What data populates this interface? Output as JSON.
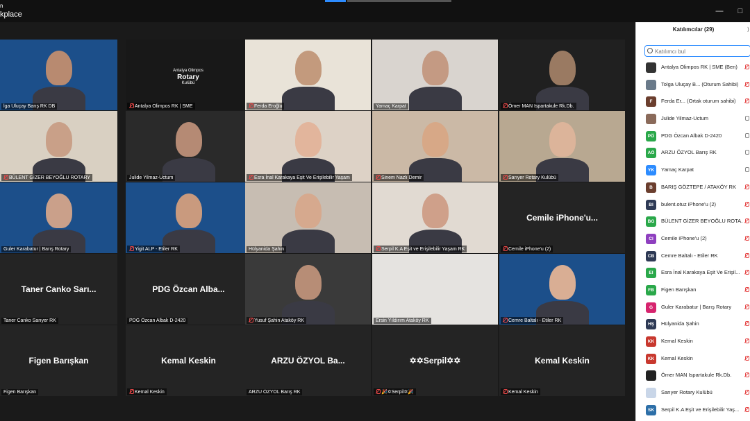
{
  "window": {
    "title": "kplace",
    "title_top": "n"
  },
  "panel": {
    "title": "Katılımcılar (29)",
    "search_placeholder": "Katılımcı bul",
    "participants": [
      {
        "initials": "",
        "name": "Antalya Olimpos RK | SME (Ben)",
        "color": "#333333",
        "mic": "muted"
      },
      {
        "initials": "",
        "name": "Tolga Uluçay B...  (Oturum Sahibi)",
        "color": "#6a7a8a",
        "mic": "muted"
      },
      {
        "initials": "F",
        "name": "Ferda Er...  (Ortak oturum sahibi)",
        "color": "#6b3e2e",
        "mic": "muted"
      },
      {
        "initials": "",
        "name": "Julide Yilmaz-Uctum",
        "color": "#8a6a5a",
        "mic": "on"
      },
      {
        "initials": "PÖ",
        "name": "PDG Özcan Albak D-2420",
        "color": "#2aa84a",
        "mic": "on"
      },
      {
        "initials": "AÖ",
        "name": "ARZU ÖZYOL Barış RK",
        "color": "#2aa84a",
        "mic": "on"
      },
      {
        "initials": "YK",
        "name": "Yamaç Karpat",
        "color": "#2d8cff",
        "mic": "on"
      },
      {
        "initials": "B",
        "name": "BARIŞ GÖZTEPE / ATAKÖY RK",
        "color": "#6b3e2e",
        "mic": "muted"
      },
      {
        "initials": "BI",
        "name": "bulent.otuz iPhone'u (2)",
        "color": "#2e3a55",
        "mic": "muted"
      },
      {
        "initials": "BG",
        "name": "BÜLENT GİZER BEYOĞLU ROTA...",
        "color": "#2aa84a",
        "mic": "muted"
      },
      {
        "initials": "CI",
        "name": "Cemile iPhone'u (2)",
        "color": "#8e3fbf",
        "mic": "muted"
      },
      {
        "initials": "CB",
        "name": "Cemre Baltalı - Etiler RK",
        "color": "#2e3a55",
        "mic": "muted"
      },
      {
        "initials": "EI",
        "name": "Esra İnal Karakaya Eşit Ve Erişil...",
        "color": "#2aa84a",
        "mic": "muted"
      },
      {
        "initials": "FB",
        "name": "Figen Barışkan",
        "color": "#2aa84a",
        "mic": "muted"
      },
      {
        "initials": "G",
        "name": "Guler Karabatur | Barış Rotary",
        "color": "#d6246e",
        "mic": "muted"
      },
      {
        "initials": "HŞ",
        "name": "Hülyanida Şahin",
        "color": "#2e3a55",
        "mic": "muted"
      },
      {
        "initials": "KK",
        "name": "Kemal Keskin",
        "color": "#c8382e",
        "mic": "muted"
      },
      {
        "initials": "KK",
        "name": "Kemal Keskin",
        "color": "#c8382e",
        "mic": "muted"
      },
      {
        "initials": "",
        "name": "Ömer MAN   Ispartakule  Rk.Db.",
        "color": "#222222",
        "mic": "muted"
      },
      {
        "initials": "",
        "name": "Sarıyer Rotary Kulübü",
        "color": "#c9d6e8",
        "mic": "muted"
      },
      {
        "initials": "SK",
        "name": "Serpil K.A Eşit ve Erişilebilir Yaş...",
        "color": "#2d6fa8",
        "mic": "muted"
      }
    ]
  },
  "tiles": [
    {
      "name": "lga Uluçay Barış RK DB",
      "big": "",
      "mic": false,
      "bg": "#1c4f8a",
      "person": "#b88a70"
    },
    {
      "name": "Antalya Olimpos RK | SME",
      "big": "",
      "mic": true,
      "bg": "#181818",
      "person": "",
      "logo_text": "Antalya Olimpos",
      "logo_brand": "Rotary",
      "logo_sub": "Kulübü"
    },
    {
      "name": "Ferda Eroğlu",
      "big": "",
      "mic": true,
      "bg": "#e9e3d8",
      "person": "#c39a7d"
    },
    {
      "name": "Yamaç Karpat",
      "big": "",
      "mic": false,
      "bg": "#d9d4cf",
      "person": "#c49a83"
    },
    {
      "name": "Ömer MAN   Ispartakule  Rk.Db.",
      "big": "",
      "mic": true,
      "bg": "#202020",
      "person": "#9a7a62"
    },
    {
      "name": "BÜLENT GİZER BEYOĞLU ROTARY",
      "big": "",
      "mic": true,
      "bg": "#d9d0c2",
      "person": "#c9a088"
    },
    {
      "name": "Julide Yilmaz-Uctum",
      "big": "",
      "mic": false,
      "bg": "#2a2a2a",
      "person": "#b58a74"
    },
    {
      "name": "Esra İnal Karakaya Eşit Ve Erişilebilir Yaşam",
      "big": "",
      "mic": true,
      "bg": "#ddd2c6",
      "person": "#e2b59c"
    },
    {
      "name": "Sinem Nazlı Demir",
      "big": "",
      "mic": true,
      "bg": "#cbb9a6",
      "person": "#d7a887"
    },
    {
      "name": "Sarıyer Rotary Kulübü",
      "big": "",
      "mic": true,
      "bg": "#b8a891",
      "person": "#dcb49a"
    },
    {
      "name": "Guler Karabatur | Barış Rotary",
      "big": "",
      "mic": false,
      "bg": "#1c4f8a",
      "person": "#caa08a"
    },
    {
      "name": "Yigit ALP - Etiler RK",
      "big": "",
      "mic": true,
      "bg": "#1c4f8a",
      "person": "#c99a7e"
    },
    {
      "name": "Hülyanida Şahin",
      "big": "",
      "mic": false,
      "bg": "#c7bdb2",
      "person": "#d6a98e"
    },
    {
      "name": "Serpil K.A Eşit ve Erişilebilir Yaşam RK",
      "big": "",
      "mic": true,
      "bg": "#e1dad2",
      "person": "#cfa08a"
    },
    {
      "name": "Cemile iPhone'u (2)",
      "big": "Cemile  iPhone'u...",
      "mic": true,
      "bg": "#242424",
      "person": ""
    },
    {
      "name": "Taner Canko Sarıyer RK",
      "big": "Taner Canko Sarı...",
      "mic": false,
      "bg": "#242424",
      "person": ""
    },
    {
      "name": "PDG Özcan Albak D-2420",
      "big": "PDG Özcan Alba...",
      "mic": false,
      "bg": "#242424",
      "person": ""
    },
    {
      "name": "Yusuf Şahin Ataköy RK",
      "big": "",
      "mic": true,
      "bg": "#3a3a3a",
      "person": "#b78d76"
    },
    {
      "name": "Ersin Yıldırım Ataköy RK",
      "big": "",
      "mic": false,
      "bg": "#e5e3e0",
      "person": ""
    },
    {
      "name": "Cemre Baltalı - Etiler RK",
      "big": "",
      "mic": true,
      "bg": "#1c4f8a",
      "person": "#d9ae94"
    },
    {
      "name": "Figen Barışkan",
      "big": "Figen Barışkan",
      "mic": false,
      "bg": "#242424",
      "person": ""
    },
    {
      "name": "Kemal Keskin",
      "big": "Kemal Keskin",
      "mic": true,
      "bg": "#242424",
      "person": ""
    },
    {
      "name": "ARZU ÖZYOL Barış RK",
      "big": "ARZU  ÖZYOL Ba...",
      "mic": false,
      "bg": "#242424",
      "person": ""
    },
    {
      "name": "🎉✡Serpil✡🎉",
      "big": "✡✡Serpil✡✡",
      "mic": true,
      "bg": "#242424",
      "person": ""
    },
    {
      "name": "Kemal Keskin",
      "big": "Kemal Keskin",
      "mic": true,
      "bg": "#242424",
      "person": ""
    }
  ],
  "active_tile": 6
}
